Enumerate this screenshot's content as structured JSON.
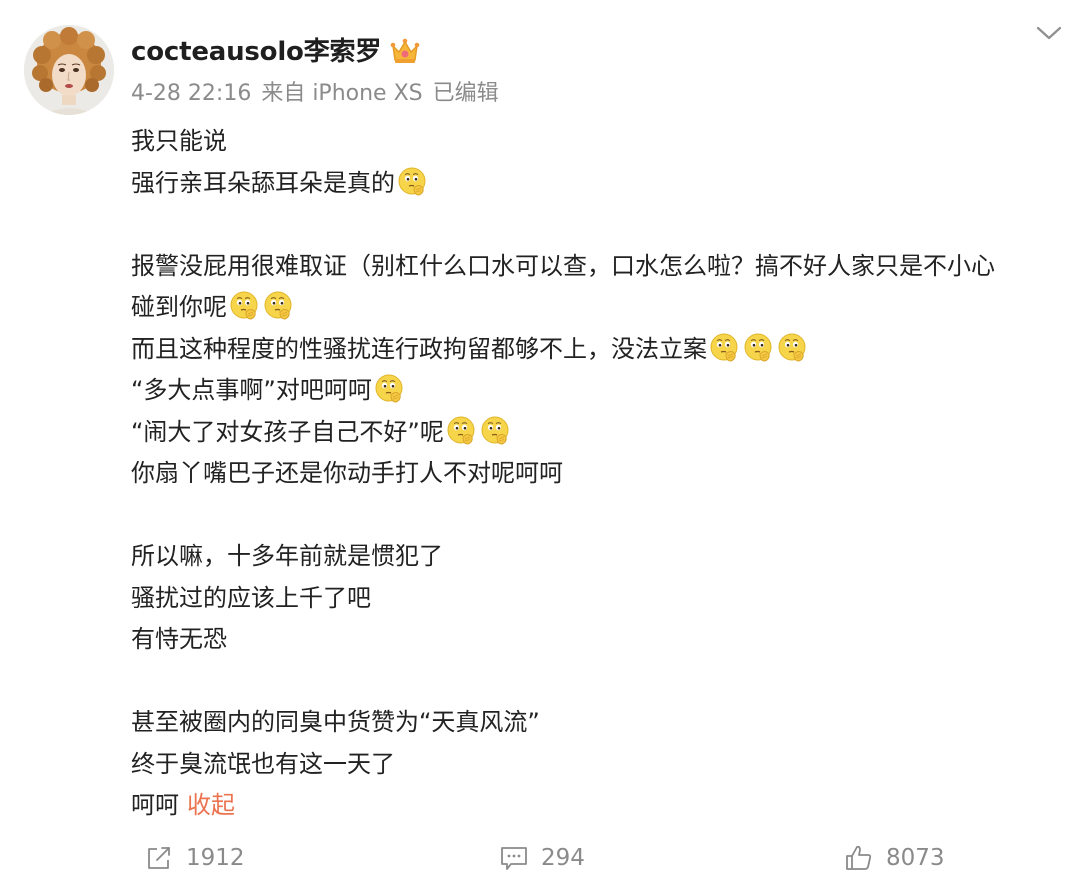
{
  "post": {
    "author": {
      "name": "cocteausolo李索罗",
      "badge_icon": "crown-icon",
      "avatar_icon": "portrait-avatar"
    },
    "meta": {
      "date": "4-28 22:16",
      "source": "来自 iPhone XS",
      "edited": "已编辑"
    },
    "menu_icon": "chevron-down-icon",
    "body": {
      "l1": "我只能说",
      "l2": "强行亲耳朵舔耳朵是真的",
      "l4": "报警没屁用很难取证（别杠什么口水可以查，口水怎么啦？搞不好人家只是不小心",
      "l5": "碰到你呢",
      "l6": "而且这种程度的性骚扰连行政拘留都够不上，没法立案",
      "l7": "“多大点事啊”对吧呵呵",
      "l8": "“闹大了对女孩子自己不好”呢",
      "l9": "你扇丫嘴巴子还是你动手打人不对呢呵呵",
      "l11": "所以嘛，十多年前就是惯犯了",
      "l12": "骚扰过的应该上千了吧",
      "l13": "有恃无恐",
      "l15": "甚至被圈内的同臭中货赞为“天真风流”",
      "l16": "终于臭流氓也有这一天了",
      "l17": "呵呵",
      "collapse_label": "收起"
    },
    "emoji_icon": "thinking-face-icon",
    "accent_color": "#eb7350"
  },
  "actions": {
    "share_count": "1912",
    "comment_count": "294",
    "like_count": "8073"
  }
}
